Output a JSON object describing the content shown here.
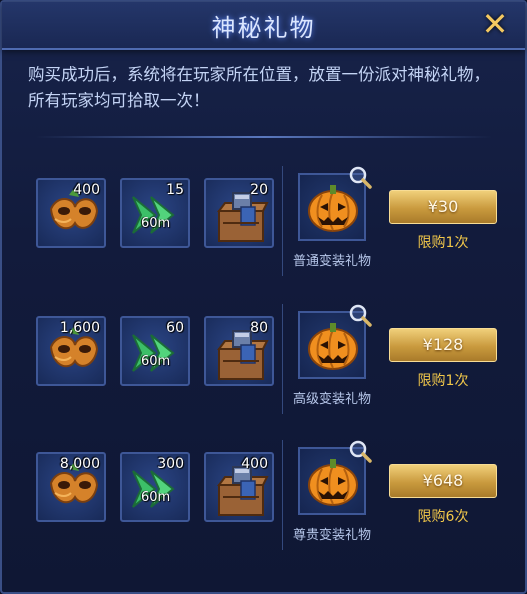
{
  "dialog": {
    "title": "神秘礼物",
    "close_icon": "close-x-icon",
    "description": "购买成功后，系统将在玩家所在位置，放置一份派对神秘礼物，所有玩家均可拾取一次！"
  },
  "colors": {
    "accent_gold": "#f2c84a",
    "panel_bg": "#121b3c",
    "border_blue": "#3e5797"
  },
  "packages": [
    {
      "items": [
        {
          "icon": "mask-icon",
          "count": "400"
        },
        {
          "icon": "speed-boost-icon",
          "count": "15",
          "duration": "60m"
        },
        {
          "icon": "treasure-crate-icon",
          "count": "20"
        }
      ],
      "gift_icon": "pumpkin-icon",
      "gift_name": "普通变装礼物",
      "price": "¥30",
      "limit": "限购1次"
    },
    {
      "items": [
        {
          "icon": "mask-icon",
          "count": "1,600"
        },
        {
          "icon": "speed-boost-icon",
          "count": "60",
          "duration": "60m"
        },
        {
          "icon": "treasure-crate-icon",
          "count": "80"
        }
      ],
      "gift_icon": "pumpkin-icon",
      "gift_name": "高级变装礼物",
      "price": "¥128",
      "limit": "限购1次"
    },
    {
      "items": [
        {
          "icon": "mask-icon",
          "count": "8,000"
        },
        {
          "icon": "speed-boost-icon",
          "count": "300",
          "duration": "60m"
        },
        {
          "icon": "treasure-crate-icon",
          "count": "400"
        }
      ],
      "gift_icon": "pumpkin-icon",
      "gift_name": "尊贵变装礼物",
      "price": "¥648",
      "limit": "限购6次"
    }
  ]
}
